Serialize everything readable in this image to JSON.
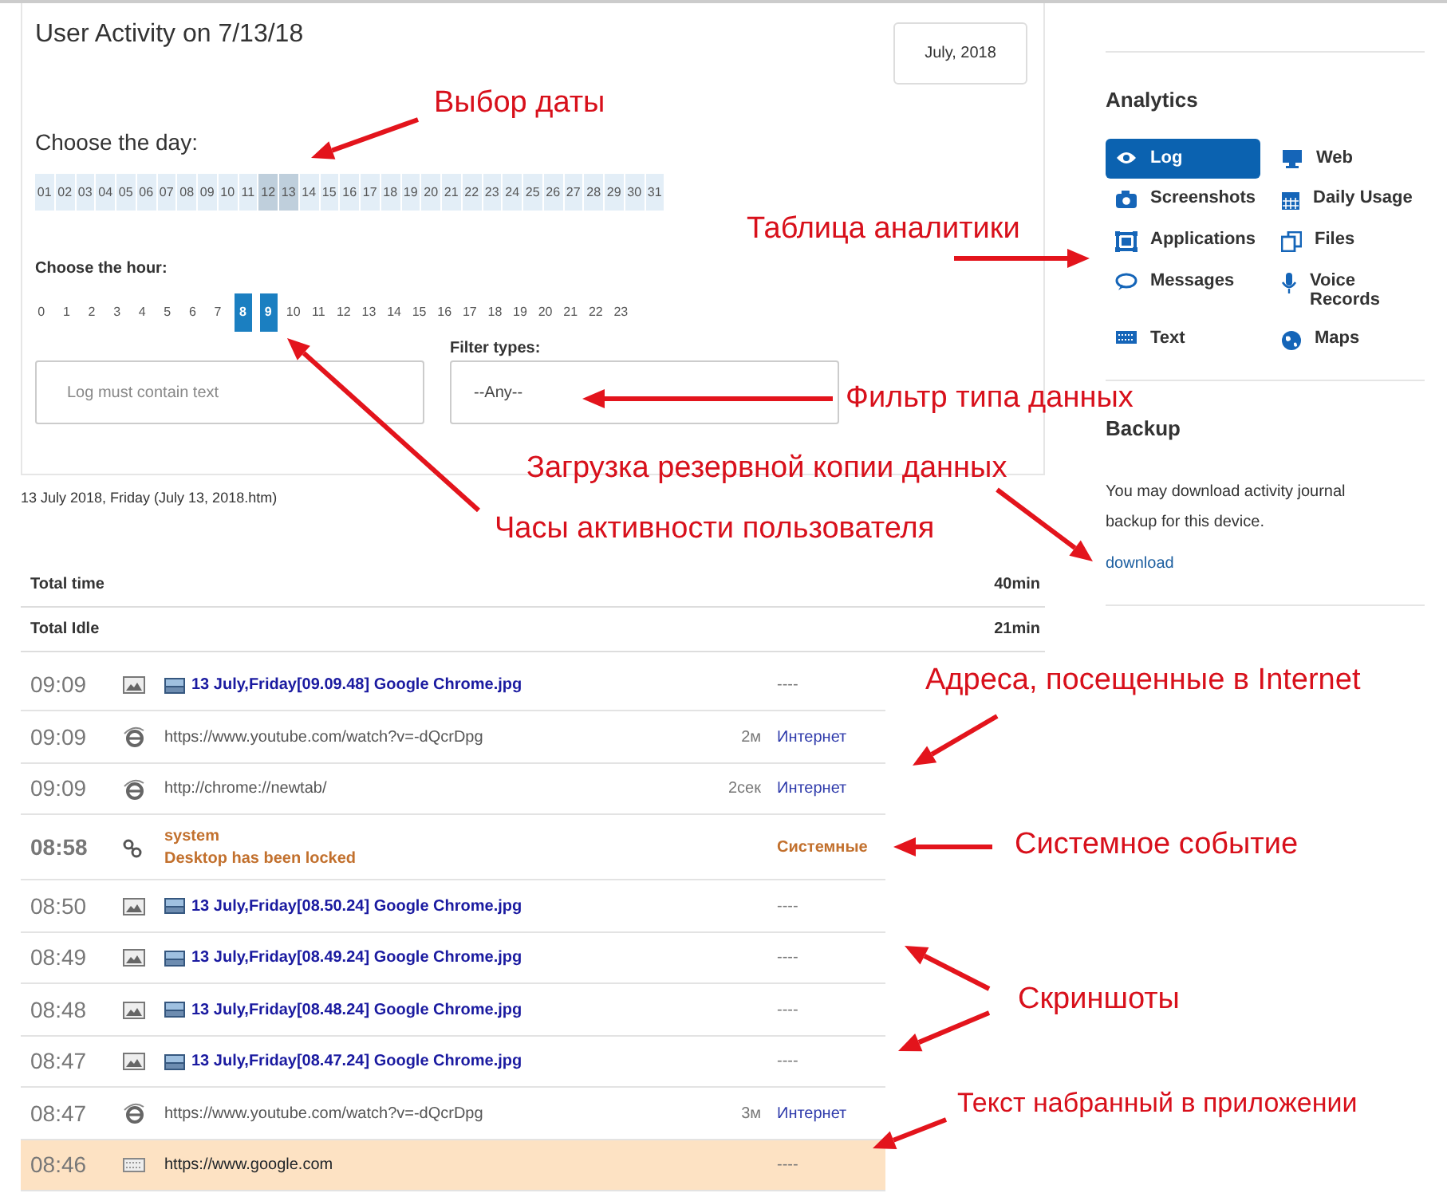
{
  "title": "User Activity on 7/13/18",
  "month_button": "July, 2018",
  "day_picker": {
    "label": "Choose the day:",
    "days": [
      {
        "label": "01",
        "selected": false
      },
      {
        "label": "02",
        "selected": false
      },
      {
        "label": "03",
        "selected": false
      },
      {
        "label": "04",
        "selected": false
      },
      {
        "label": "05",
        "selected": false
      },
      {
        "label": "06",
        "selected": false
      },
      {
        "label": "07",
        "selected": false
      },
      {
        "label": "08",
        "selected": false
      },
      {
        "label": "09",
        "selected": false
      },
      {
        "label": "10",
        "selected": false
      },
      {
        "label": "11",
        "selected": false
      },
      {
        "label": "12",
        "selected": true
      },
      {
        "label": "13",
        "selected": true
      },
      {
        "label": "14",
        "selected": false
      },
      {
        "label": "15",
        "selected": false
      },
      {
        "label": "16",
        "selected": false
      },
      {
        "label": "17",
        "selected": false
      },
      {
        "label": "18",
        "selected": false
      },
      {
        "label": "19",
        "selected": false
      },
      {
        "label": "20",
        "selected": false
      },
      {
        "label": "21",
        "selected": false
      },
      {
        "label": "22",
        "selected": false
      },
      {
        "label": "23",
        "selected": false
      },
      {
        "label": "24",
        "selected": false
      },
      {
        "label": "25",
        "selected": false
      },
      {
        "label": "26",
        "selected": false
      },
      {
        "label": "27",
        "selected": false
      },
      {
        "label": "28",
        "selected": false
      },
      {
        "label": "29",
        "selected": false
      },
      {
        "label": "30",
        "selected": false
      },
      {
        "label": "31",
        "selected": false
      }
    ]
  },
  "hour_picker": {
    "label": "Choose the hour:",
    "hours": [
      {
        "label": "0",
        "selected": false
      },
      {
        "label": "1",
        "selected": false
      },
      {
        "label": "2",
        "selected": false
      },
      {
        "label": "3",
        "selected": false
      },
      {
        "label": "4",
        "selected": false
      },
      {
        "label": "5",
        "selected": false
      },
      {
        "label": "6",
        "selected": false
      },
      {
        "label": "7",
        "selected": false
      },
      {
        "label": "8",
        "selected": true
      },
      {
        "label": "9",
        "selected": true
      },
      {
        "label": "10",
        "selected": false
      },
      {
        "label": "11",
        "selected": false
      },
      {
        "label": "12",
        "selected": false
      },
      {
        "label": "13",
        "selected": false
      },
      {
        "label": "14",
        "selected": false
      },
      {
        "label": "15",
        "selected": false
      },
      {
        "label": "16",
        "selected": false
      },
      {
        "label": "17",
        "selected": false
      },
      {
        "label": "18",
        "selected": false
      },
      {
        "label": "19",
        "selected": false
      },
      {
        "label": "20",
        "selected": false
      },
      {
        "label": "21",
        "selected": false
      },
      {
        "label": "22",
        "selected": false
      },
      {
        "label": "23",
        "selected": false
      }
    ]
  },
  "text_filter": {
    "placeholder": "Log must contain text"
  },
  "type_filter": {
    "label": "Filter types:",
    "value": "--Any--"
  },
  "caption": "13 July 2018, Friday (July 13, 2018.htm)",
  "totals": [
    {
      "label": "Total time",
      "value": "40min"
    },
    {
      "label": "Total Idle",
      "value": "21min"
    }
  ],
  "log": [
    {
      "kind": "screenshot",
      "time": "09:09",
      "text": "13 July,Friday[09.09.48] Google Chrome.jpg",
      "category": "----",
      "highlighted": false
    },
    {
      "kind": "web",
      "time": "09:09",
      "text": "https://www.youtube.com/watch?v=-dQcrDpg",
      "duration": "2м",
      "category": "Интернет",
      "highlighted": false
    },
    {
      "kind": "web",
      "time": "09:09",
      "text": "http://chrome://newtab/",
      "duration": "2сек",
      "category": "Интернет",
      "highlighted": false
    },
    {
      "kind": "system",
      "time": "08:58",
      "text": "system",
      "detail": "Desktop has been locked",
      "category": "Системные",
      "highlighted": false
    },
    {
      "kind": "screenshot",
      "time": "08:50",
      "text": "13 July,Friday[08.50.24] Google Chrome.jpg",
      "category": "----",
      "highlighted": false
    },
    {
      "kind": "screenshot",
      "time": "08:49",
      "text": "13 July,Friday[08.49.24] Google Chrome.jpg",
      "category": "----",
      "highlighted": false
    },
    {
      "kind": "screenshot",
      "time": "08:48",
      "text": "13 July,Friday[08.48.24] Google Chrome.jpg",
      "category": "----",
      "highlighted": false
    },
    {
      "kind": "screenshot",
      "time": "08:47",
      "text": "13 July,Friday[08.47.24] Google Chrome.jpg",
      "category": "----",
      "highlighted": false
    },
    {
      "kind": "web",
      "time": "08:47",
      "text": "https://www.youtube.com/watch?v=-dQcrDpg",
      "duration": "3м",
      "category": "Интернет",
      "highlighted": false
    },
    {
      "kind": "typed",
      "time": "08:46",
      "text": "https://www.google.com",
      "category": "----",
      "highlighted": true
    }
  ],
  "sidebar": {
    "analytics_title": "Analytics",
    "items": [
      {
        "label": "Log",
        "selected": true
      },
      {
        "label": "Web",
        "selected": false
      },
      {
        "label": "Screenshots",
        "selected": false
      },
      {
        "label": "Daily Usage",
        "selected": false
      },
      {
        "label": "Applications",
        "selected": false
      },
      {
        "label": "Files",
        "selected": false
      },
      {
        "label": "Messages",
        "selected": false
      },
      {
        "label": "Voice Records",
        "selected": false
      },
      {
        "label": "Text",
        "selected": false
      },
      {
        "label": "Maps",
        "selected": false
      }
    ],
    "backup_title": "Backup",
    "backup_text": "You may download activity journal backup for this device.",
    "backup_link": "download"
  },
  "annotations": [
    {
      "text": "Выбор даты"
    },
    {
      "text": "Таблица аналитики"
    },
    {
      "text": "Фильтр типа данных"
    },
    {
      "text": "Загрузка резервной копии данных"
    },
    {
      "text": "Часы активности пользователя"
    },
    {
      "text": "Адреса, посещенные в Internet"
    },
    {
      "text": "Системное событие"
    },
    {
      "text": "Скриншоты"
    },
    {
      "text": "Текст набранный в приложении"
    }
  ]
}
